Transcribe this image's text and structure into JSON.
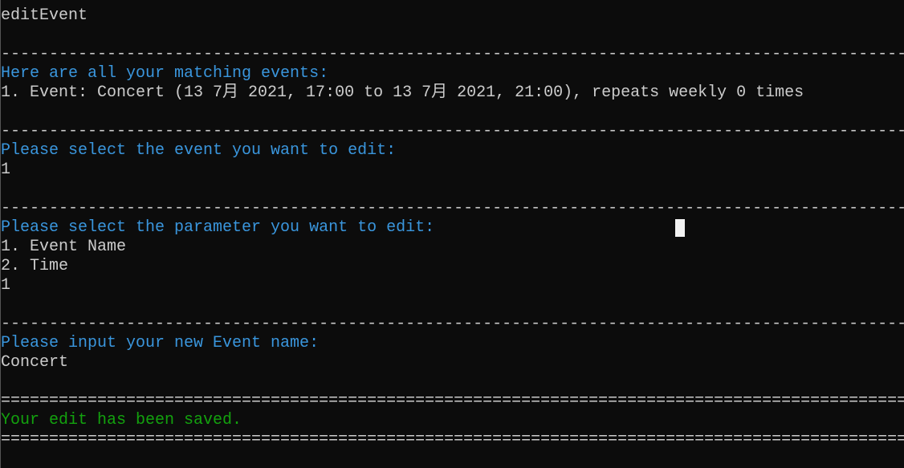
{
  "terminal": {
    "colors": {
      "background": "#0c0c0c",
      "text": "#cccccc",
      "prompt": "#3a96dd",
      "success": "#13a10e"
    },
    "lines": {
      "command": "editEvent",
      "rule_dash": "----------------------------------------------------------------------------------------------",
      "rule_equal": "==============================================================================================",
      "matching_header": "Here are all your matching events:",
      "event_1": "1. Event: Concert (13 7月 2021, 17:00 to 13 7月 2021, 21:00), repeats weekly 0 times",
      "select_event_prompt": "Please select the event you want to edit:",
      "select_event_input": "1",
      "select_param_prompt": "Please select the parameter you want to edit:",
      "param_option_1": "1. Event Name",
      "param_option_2": "2. Time",
      "select_param_input": "1",
      "new_name_prompt": "Please input your new Event name:",
      "new_name_input": "Concert",
      "saved_message": "Your edit has been saved."
    }
  }
}
